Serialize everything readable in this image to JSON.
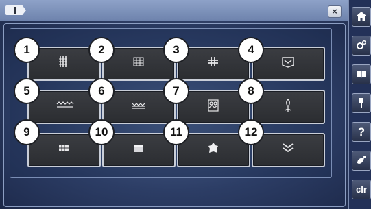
{
  "window": {
    "close_label": "×"
  },
  "tiles": [
    {
      "number": "1",
      "icon": "stitch-pattern-1-icon"
    },
    {
      "number": "2",
      "icon": "stitch-pattern-2-icon"
    },
    {
      "number": "3",
      "icon": "stitch-pattern-3-icon"
    },
    {
      "number": "4",
      "icon": "stitch-pattern-4-icon"
    },
    {
      "number": "5",
      "icon": "stitch-pattern-5-icon"
    },
    {
      "number": "6",
      "icon": "stitch-pattern-6-icon"
    },
    {
      "number": "7",
      "icon": "stitch-pattern-7-icon"
    },
    {
      "number": "8",
      "icon": "stitch-pattern-8-icon"
    },
    {
      "number": "9",
      "icon": "stitch-pattern-9-icon"
    },
    {
      "number": "10",
      "icon": "stitch-pattern-10-icon"
    },
    {
      "number": "11",
      "icon": "stitch-pattern-11-icon"
    },
    {
      "number": "12",
      "icon": "stitch-pattern-12-icon"
    }
  ],
  "toolbar": {
    "home_icon": "home-icon",
    "settings_icon": "settings-icon",
    "book_icon": "book-icon",
    "needle_icon": "needle-icon",
    "help_label": "?",
    "eco_icon": "eco-icon",
    "clear_label": "clr"
  },
  "colors": {
    "background": "#2f3f66",
    "tile": "#333539",
    "tile_border": "#c9ced8",
    "badge": "#ffffff"
  }
}
